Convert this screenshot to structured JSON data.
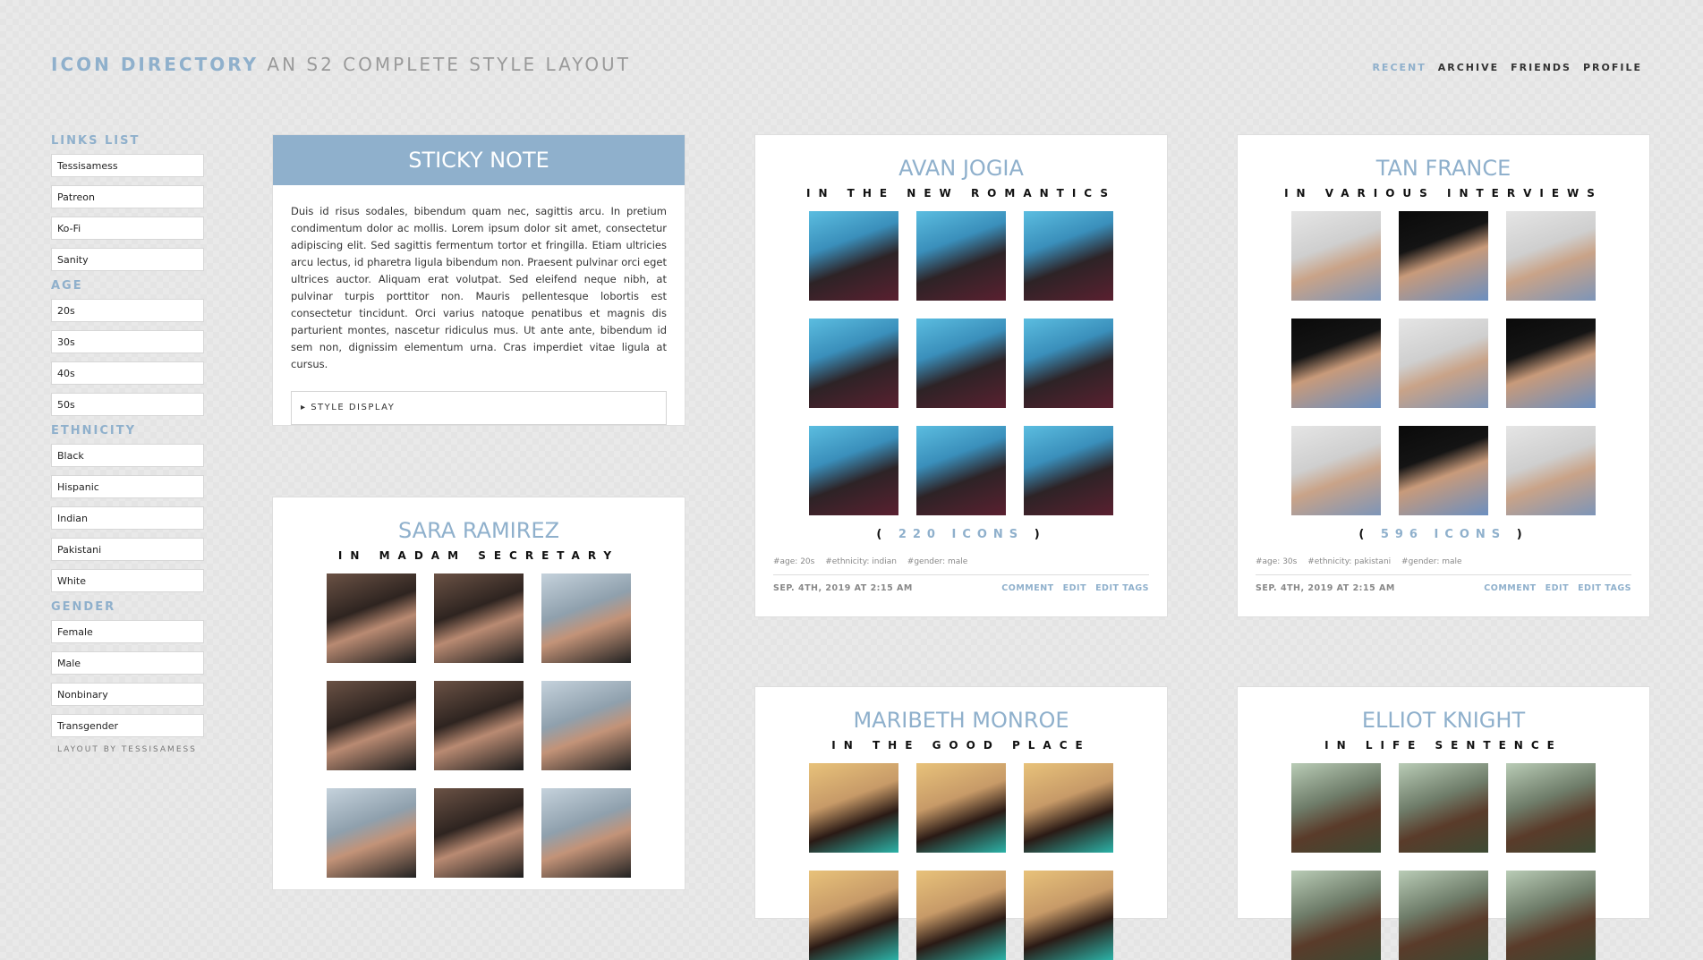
{
  "header": {
    "title": "ICON DIRECTORY",
    "subtitle": "AN S2 COMPLETE STYLE LAYOUT",
    "nav": [
      "RECENT",
      "ARCHIVE",
      "FRIENDS",
      "PROFILE"
    ]
  },
  "sidebar": {
    "sections": [
      {
        "heading": "LINKS LIST",
        "items": [
          "Tessisamess",
          "Patreon",
          "Ko-Fi",
          "Sanity"
        ]
      },
      {
        "heading": "AGE",
        "items": [
          "20s",
          "30s",
          "40s",
          "50s"
        ]
      },
      {
        "heading": "ETHNICITY",
        "items": [
          "Black",
          "Hispanic",
          "Indian",
          "Pakistani",
          "White"
        ]
      },
      {
        "heading": "GENDER",
        "items": [
          "Female",
          "Male",
          "Nonbinary",
          "Transgender"
        ]
      }
    ],
    "credit": "LAYOUT BY TESSISAMESS"
  },
  "sticky": {
    "title": "STICKY NOTE",
    "body": "Duis id risus sodales, bibendum quam nec, sagittis arcu. In pretium condimentum dolor ac mollis. Lorem ipsum dolor sit amet, consectetur adipiscing elit. Sed sagittis fermentum tortor et fringilla. Etiam ultricies arcu lectus, id pharetra ligula bibendum non. Praesent pulvinar orci eget ultrices auctor. Aliquam erat volutpat. Sed eleifend neque nibh, at pulvinar turpis porttitor non. Mauris pellentesque lobortis est consectetur tincidunt. Orci varius natoque penatibus et magnis dis parturient montes, nascetur ridiculus mus. Ut ante ante, bibendum id sem non, dignissim elementum urna. Cras imperdiet vitae ligula at cursus.",
    "toggle": "▸ STYLE DISPLAY"
  },
  "posts": {
    "avan": {
      "name": "AVAN JOGIA",
      "subtitle": "IN THE NEW ROMANTICS",
      "count_open": "(",
      "count_num": "220 ICONS",
      "count_close": ")",
      "tags": [
        "#age: 20s",
        "#ethnicity: indian",
        "#gender: male"
      ],
      "date": "SEP. 4TH, 2019 AT 2:15 AM"
    },
    "tan": {
      "name": "TAN FRANCE",
      "subtitle": "IN VARIOUS INTERVIEWS",
      "count_open": "(",
      "count_num": "596 ICONS",
      "count_close": ")",
      "tags": [
        "#age: 30s",
        "#ethnicity: pakistani",
        "#gender: male"
      ],
      "date": "SEP. 4TH, 2019 AT 2:15 AM"
    },
    "sara": {
      "name": "SARA RAMIREZ",
      "subtitle": "IN MADAM SECRETARY"
    },
    "mari": {
      "name": "MARIBETH MONROE",
      "subtitle": "IN THE GOOD PLACE"
    },
    "elliot": {
      "name": "ELLIOT KNIGHT",
      "subtitle": "IN LIFE SENTENCE"
    }
  },
  "actions": {
    "comment": "COMMENT",
    "edit": "EDIT",
    "edit_tags": "EDIT TAGS"
  }
}
